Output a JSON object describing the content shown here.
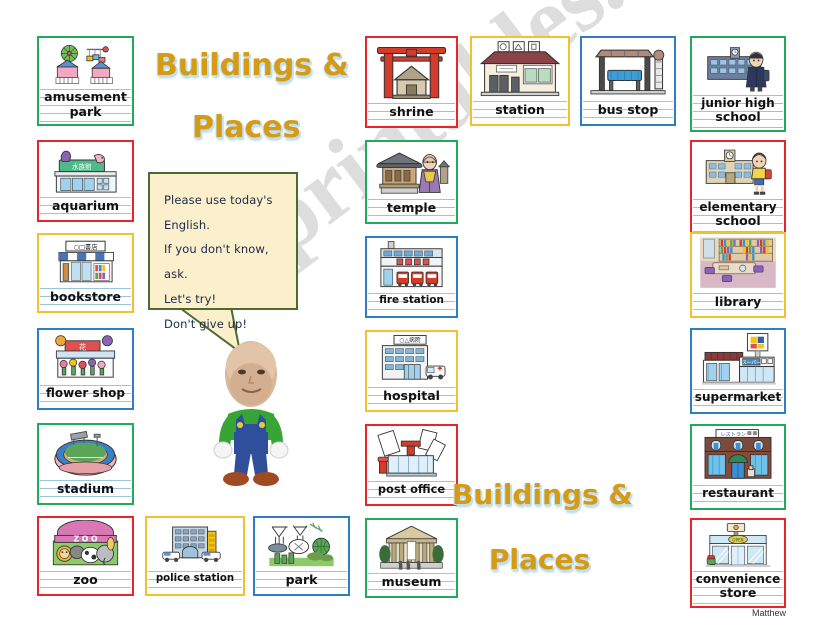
{
  "page": {
    "title_top": [
      "Buildings &",
      "Places"
    ],
    "title_bottom": [
      "Buildings &",
      "Places"
    ],
    "signature": "Matthew",
    "watermark": "eslprintables.com",
    "accent_gold": "#d59b15",
    "accent_shadow": "#bfe0f2"
  },
  "bubble": {
    "border_color": "#4c6b2f",
    "fill_color": "#fbf0cb",
    "lines": [
      "Please use today's English.",
      "If you don't know, ask.",
      "Let's try!",
      "Don't give up!"
    ]
  },
  "cards": [
    {
      "id": "amusement-park",
      "label": [
        "amusement",
        "park"
      ],
      "border": "#22a95a",
      "icon": "amusement-park-icon"
    },
    {
      "id": "aquarium",
      "label": [
        "aquarium"
      ],
      "border": "#e8252b",
      "icon": "aquarium-icon"
    },
    {
      "id": "bookstore",
      "label": [
        "bookstore"
      ],
      "border": "#f2c12e",
      "icon": "bookstore-icon"
    },
    {
      "id": "flower-shop",
      "label": [
        "flower shop"
      ],
      "border": "#2f7dc4",
      "icon": "flower-shop-icon"
    },
    {
      "id": "stadium",
      "label": [
        "stadium"
      ],
      "border": "#22a95a",
      "icon": "stadium-icon"
    },
    {
      "id": "zoo",
      "label": [
        "zoo"
      ],
      "border": "#e8252b",
      "icon": "zoo-icon"
    },
    {
      "id": "police-station",
      "label": [
        "police station"
      ],
      "border": "#f2c12e",
      "icon": "police-station-icon"
    },
    {
      "id": "park",
      "label": [
        "park"
      ],
      "border": "#2f7dc4",
      "icon": "park-icon"
    },
    {
      "id": "shrine",
      "label": [
        "shrine"
      ],
      "border": "#e8252b",
      "icon": "shrine-icon"
    },
    {
      "id": "temple",
      "label": [
        "temple"
      ],
      "border": "#22a95a",
      "icon": "temple-icon"
    },
    {
      "id": "fire-station",
      "label": [
        "fire station"
      ],
      "border": "#2f7dc4",
      "icon": "fire-station-icon"
    },
    {
      "id": "hospital",
      "label": [
        "hospital"
      ],
      "border": "#f2c12e",
      "icon": "hospital-icon"
    },
    {
      "id": "post-office",
      "label": [
        "post office"
      ],
      "border": "#e8252b",
      "icon": "post-office-icon"
    },
    {
      "id": "museum",
      "label": [
        "museum"
      ],
      "border": "#22a95a",
      "icon": "museum-icon"
    },
    {
      "id": "station",
      "label": [
        "station"
      ],
      "border": "#f2c12e",
      "icon": "station-icon"
    },
    {
      "id": "bus-stop",
      "label": [
        "bus stop"
      ],
      "border": "#2f7dc4",
      "icon": "bus-stop-icon"
    },
    {
      "id": "junior-high-school",
      "label": [
        "junior high",
        "school"
      ],
      "border": "#22a95a",
      "icon": "junior-high-school-icon"
    },
    {
      "id": "elementary-school",
      "label": [
        "elementary",
        "school"
      ],
      "border": "#e8252b",
      "icon": "elementary-school-icon"
    },
    {
      "id": "library",
      "label": [
        "library"
      ],
      "border": "#f2c12e",
      "icon": "library-icon"
    },
    {
      "id": "supermarket",
      "label": [
        "supermarket"
      ],
      "border": "#2f7dc4",
      "icon": "supermarket-icon"
    },
    {
      "id": "restaurant",
      "label": [
        "restaurant"
      ],
      "border": "#22a95a",
      "icon": "restaurant-icon"
    },
    {
      "id": "convenience-store",
      "label": [
        "convenience",
        "store"
      ],
      "border": "#e8252b",
      "icon": "convenience-store-icon"
    }
  ],
  "character": {
    "name": "teacher-avatar",
    "shirt_color": "#37a536",
    "overalls_color": "#2f4f9b",
    "shoe_color": "#a04a22"
  }
}
